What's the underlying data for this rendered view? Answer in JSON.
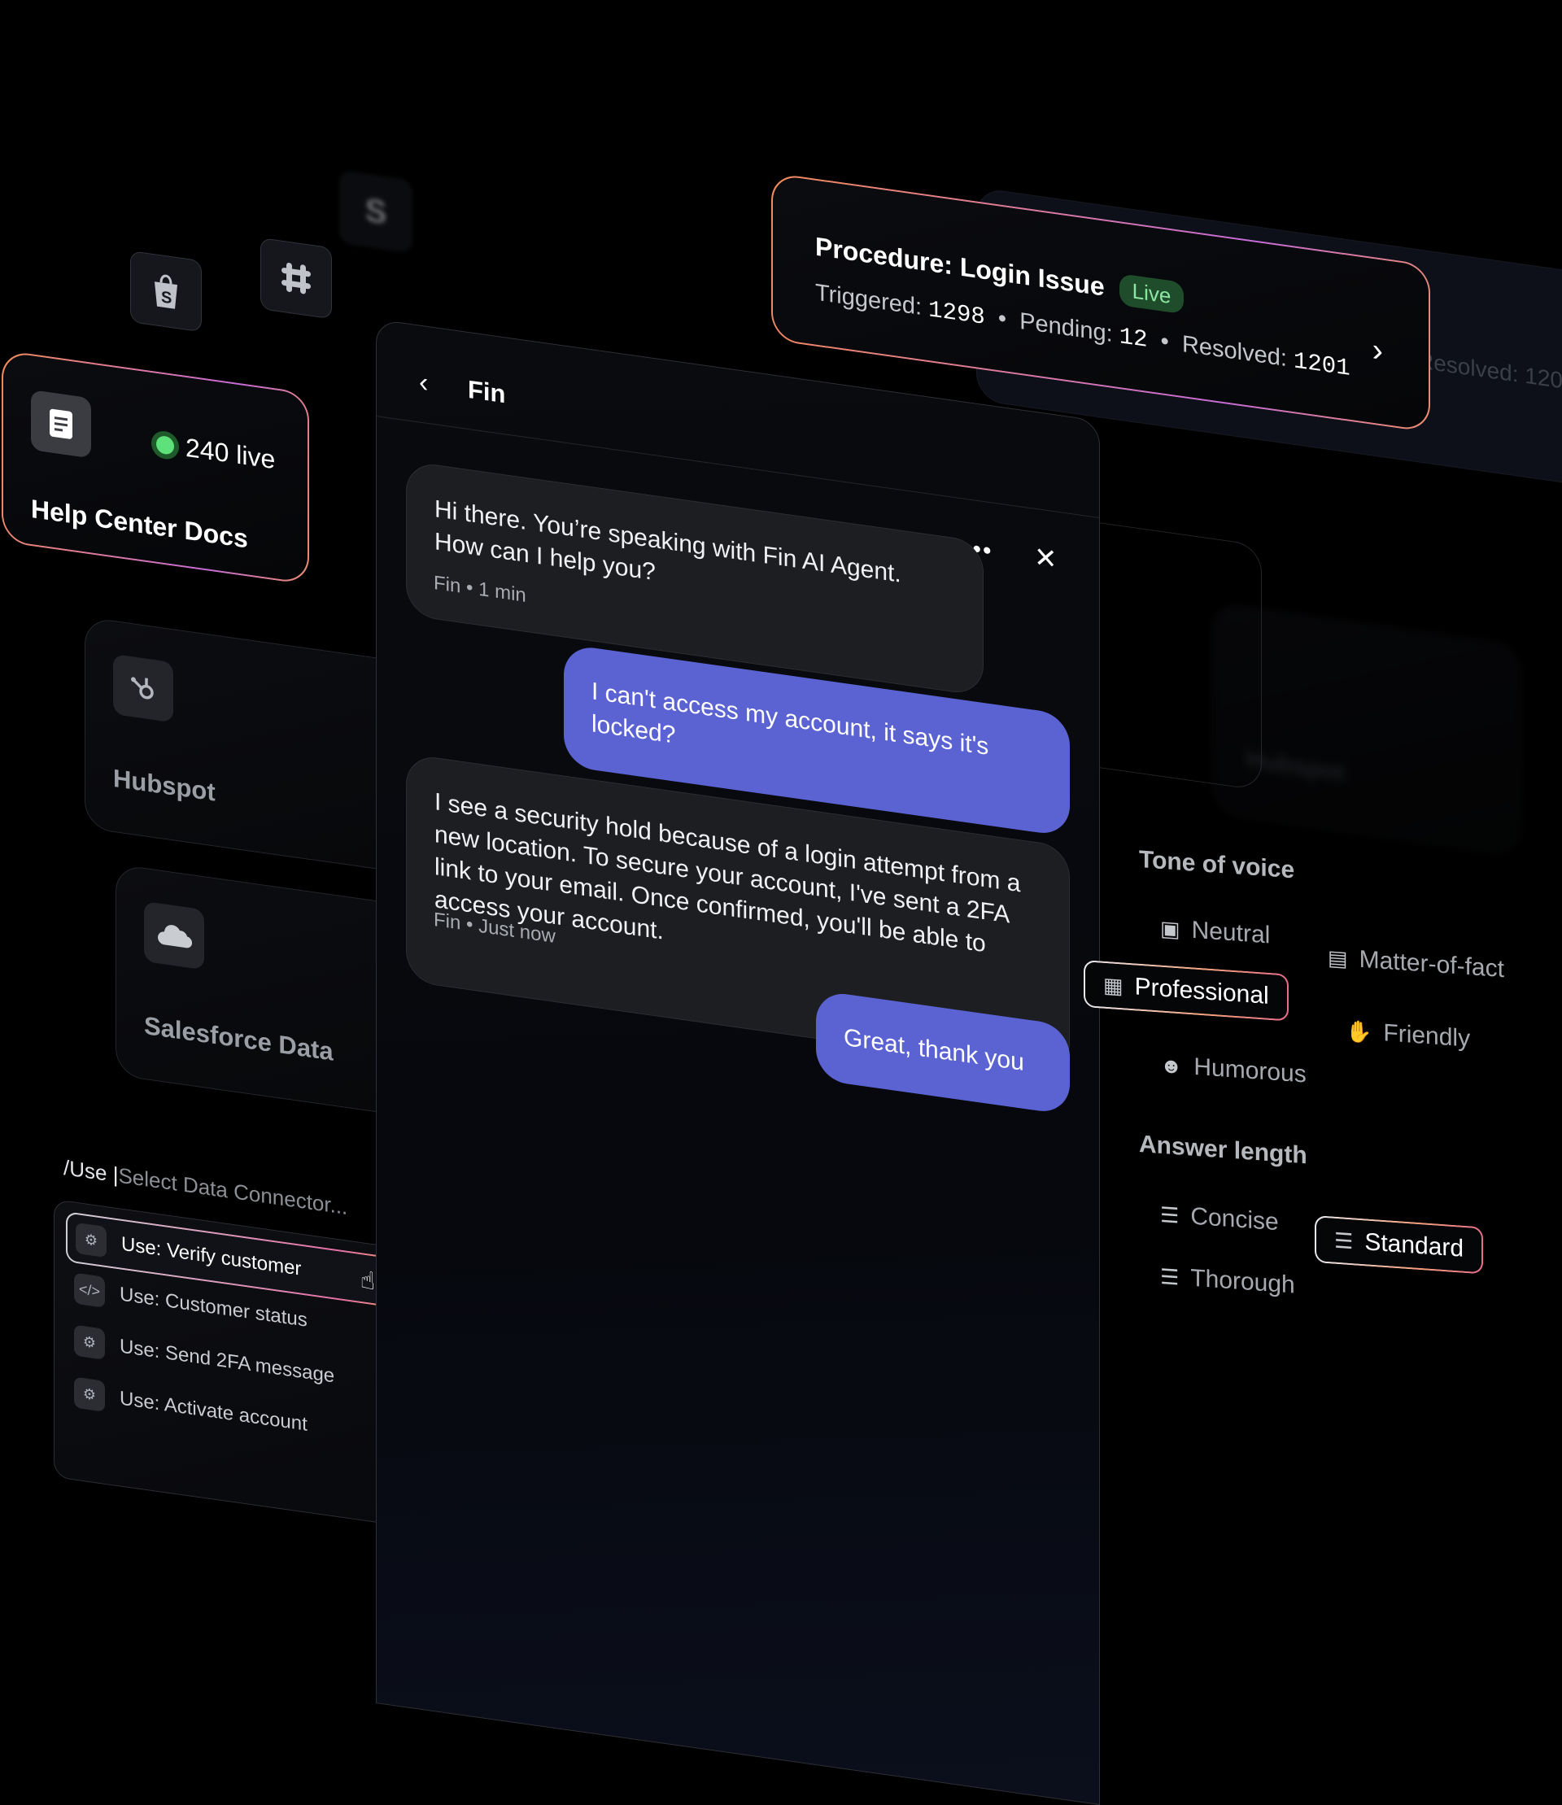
{
  "integrations": {
    "shopify_icon": "shopify-bag-icon",
    "slack_icon": "slack-hash-icon",
    "stripe_icon": "stripe-s-icon",
    "stripe_glyph": "S"
  },
  "help_center": {
    "live_label": "240 live",
    "title": "Help Center Docs"
  },
  "connectors": [
    {
      "label": "Hubspot",
      "icon": "hubspot-icon"
    },
    {
      "label": "Salesforce Data",
      "icon": "salesforce-cloud-icon"
    }
  ],
  "command": {
    "prefix": "/Use ",
    "placeholder": "Select Data Connector...",
    "items": [
      {
        "label": "Use: Verify customer",
        "icon": "webhook-icon",
        "selected": true
      },
      {
        "label": "Use: Customer status",
        "icon": "code-icon"
      },
      {
        "label": "Use: Send 2FA message",
        "icon": "webhook-icon"
      },
      {
        "label": "Use: Activate account",
        "icon": "webhook-icon"
      }
    ]
  },
  "chat": {
    "title": "Fin",
    "messages": [
      {
        "from": "bot",
        "text": "Hi there. You’re speaking with Fin AI Agent. How can I help you?",
        "meta": "Fin • 1 min"
      },
      {
        "from": "user",
        "text": "I can't access my account, it says it's locked?"
      },
      {
        "from": "bot",
        "text": "I see a security hold because of a login attempt from a new location. To secure your account, I've sent a 2FA link to your email. Once confirmed, you'll be able to access your account.",
        "meta": "Fin • Just now"
      },
      {
        "from": "user",
        "text": "Great, thank you"
      }
    ]
  },
  "procedure": {
    "title": "Procedure: Login Issue",
    "badge": "Live",
    "triggered_label": "Triggered:",
    "triggered": "1298",
    "pending_label": "Pending:",
    "pending": "12",
    "resolved_label": "Resolved:",
    "resolved": "1201",
    "ghost_text": "Resolved: 120"
  },
  "ghost": {
    "hubspot_label": "Hubspot"
  },
  "tone": {
    "title": "Tone of voice",
    "options": [
      {
        "label": "Neutral",
        "icon": "neutral-icon"
      },
      {
        "label": "Matter-of-fact",
        "icon": "document-icon"
      },
      {
        "label": "Professional",
        "icon": "briefcase-icon",
        "selected": true
      },
      {
        "label": "Friendly",
        "icon": "wave-hand-icon"
      },
      {
        "label": "Humorous",
        "icon": "smiley-icon"
      }
    ]
  },
  "length": {
    "title": "Answer length",
    "options": [
      {
        "label": "Concise",
        "icon": "short-lines-icon"
      },
      {
        "label": "Standard",
        "icon": "medium-lines-icon",
        "selected": true
      },
      {
        "label": "Thorough",
        "icon": "long-lines-icon"
      }
    ]
  },
  "colors": {
    "accent_user_bubble": "#5b63d3",
    "live_green": "#5ee07a",
    "glow_start": "#f28a5b",
    "glow_mid": "#c56bd6"
  }
}
